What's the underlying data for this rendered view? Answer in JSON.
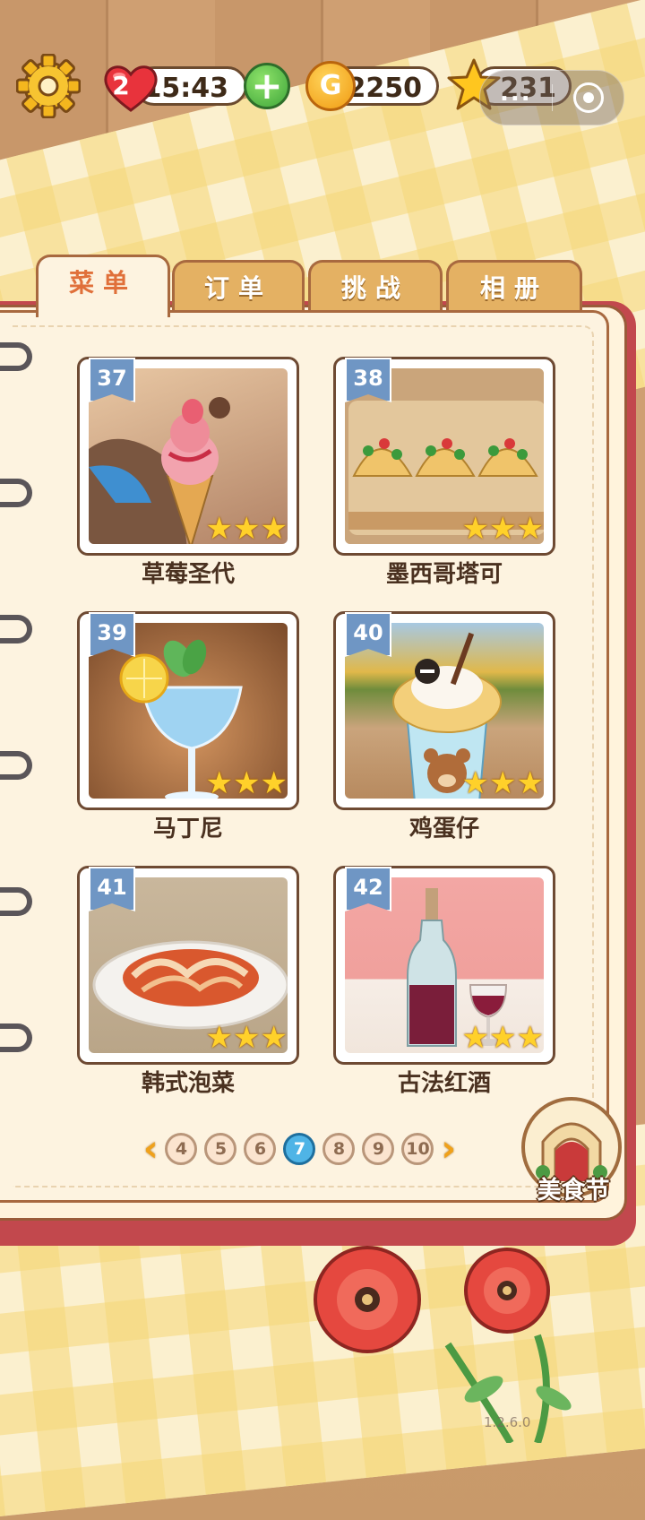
{
  "status": {
    "lives": "2",
    "timer": "15:43",
    "gold": "2250",
    "stars": "231",
    "coin_symbol": "G"
  },
  "capsule": {
    "more_label": "..."
  },
  "tabs": [
    {
      "label": "菜单",
      "active": true
    },
    {
      "label": "订单",
      "active": false
    },
    {
      "label": "挑战",
      "active": false
    },
    {
      "label": "相册",
      "active": false
    }
  ],
  "recipes": [
    {
      "number": "37",
      "name": "草莓圣代",
      "stars": 3
    },
    {
      "number": "38",
      "name": "墨西哥塔可",
      "stars": 3
    },
    {
      "number": "39",
      "name": "马丁尼",
      "stars": 3
    },
    {
      "number": "40",
      "name": "鸡蛋仔",
      "stars": 3
    },
    {
      "number": "41",
      "name": "韩式泡菜",
      "stars": 3
    },
    {
      "number": "42",
      "name": "古法红酒",
      "stars": 3
    }
  ],
  "pagination": {
    "pages": [
      "4",
      "5",
      "6",
      "7",
      "8",
      "9",
      "10"
    ],
    "current": "7",
    "prev": "‹",
    "next": "›"
  },
  "festival": {
    "label": "美食节"
  },
  "version": "1.2.6.0"
}
